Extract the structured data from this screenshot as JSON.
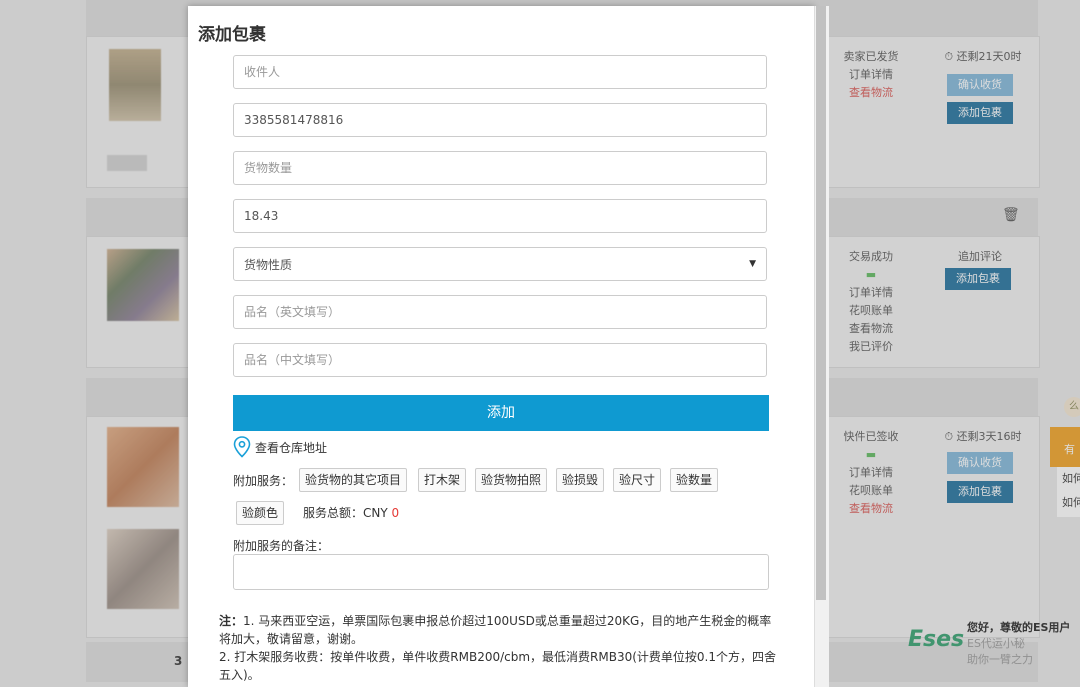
{
  "modal": {
    "title": "添加包裹",
    "fields": {
      "recipient_placeholder": "收件人",
      "tracking_value": "3385581478816",
      "quantity_placeholder": "货物数量",
      "weight_value": "18.43",
      "nature_selected": "货物性质",
      "name_en_placeholder": "品名（英文填写）",
      "name_cn_placeholder": "品名（中文填写）"
    },
    "add_button": "添加",
    "warehouse_link": "查看仓库地址",
    "services_label": "附加服务：",
    "services": [
      "验货物的其它项目",
      "打木架",
      "验货物拍照",
      "验损毁",
      "验尺寸",
      "验数量",
      "验颜色"
    ],
    "total_label": "服务总额：CNY",
    "total_value": "0",
    "remark_label": "附加服务的备注：",
    "note_prefix": "注：",
    "note_1": "1. 马来西亚空运，单票国际包裹申报总价超过100USD或总重量超过20KG，目的地产生税金的概率将加大，敬请留意，谢谢。",
    "note_2": "2. 打木架服务收费：按单件收费，单件收费RMB200/cbm，最低消费RMB30(计费单位按0.1个方，四舍五入)。"
  },
  "background": {
    "order1": {
      "status": "卖家已发货",
      "detail": "订单详情",
      "logistics": "查看物流",
      "remaining": "还剩21天0时",
      "confirm": "确认收货",
      "add_package": "添加包裹"
    },
    "order2": {
      "status": "交易成功",
      "detail": "订单详情",
      "bill": "花呗账单",
      "logistics": "查看物流",
      "rated": "我已评价",
      "follow_review": "追加评论",
      "add_package": "添加包裹"
    },
    "order3": {
      "status": "快件已签收",
      "detail": "订单详情",
      "bill": "花呗账单",
      "logistics": "查看物流",
      "remaining": "还剩3天16时",
      "confirm": "确认收货",
      "add_package": "添加包裹"
    },
    "row_number": "3",
    "side_bubble": "么",
    "side_tab": "有",
    "side_items": [
      "如何",
      "如何"
    ],
    "es_logo": "Eses",
    "es_greeting": "您好，尊敬的ES用户",
    "es_line1": "ES代运小秘",
    "es_line2": "助你一臂之力"
  },
  "colors": {
    "primary_button": "#0f9ad1",
    "zero_total": "#e53935",
    "logistics_link": "#d9534f"
  },
  "icons": [
    "location-pin-icon",
    "trash-icon",
    "dropdown-caret-icon"
  ]
}
